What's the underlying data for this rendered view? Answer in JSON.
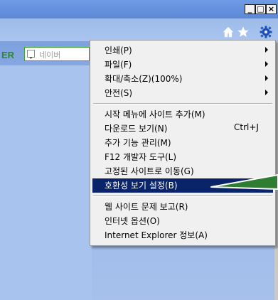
{
  "window": {
    "minimize": "_",
    "maximize": "□",
    "close": "×"
  },
  "toolbar": {
    "home_icon": "home-icon",
    "favorites_icon": "star-icon",
    "tools_icon": "gear-icon",
    "brand": "ER",
    "search_placeholder": "네이버"
  },
  "tools_menu": {
    "items": [
      {
        "label": "인쇄(P)",
        "submenu": true
      },
      {
        "label": "파일(F)",
        "submenu": true
      },
      {
        "label": "확대/축소(Z)(100%)",
        "submenu": true
      },
      {
        "label": "안전(S)",
        "submenu": true
      },
      {
        "label": "시작 메뉴에 사이트 추가(M)"
      },
      {
        "label": "다운로드 보기(N)",
        "shortcut": "Ctrl+J"
      },
      {
        "label": "추가 기능 관리(M)"
      },
      {
        "label": "F12 개발자 도구(L)"
      },
      {
        "label": "고정된 사이트로 이동(G)"
      },
      {
        "label": "호환성 보기 설정(B)",
        "highlighted": true
      },
      {
        "label": "웹 사이트 문제 보고(R)"
      },
      {
        "label": "인터넷 옵션(O)"
      },
      {
        "label": "Internet Explorer 정보(A)"
      }
    ]
  },
  "colors": {
    "highlight": "#0a246a",
    "callout_line": "#2e7d32",
    "brand_green": "#2d8a26"
  }
}
